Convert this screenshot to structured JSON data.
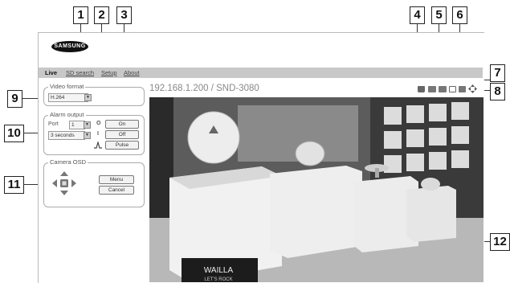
{
  "app": {
    "logo_text": "SAMSUNG",
    "menu": [
      {
        "label": "Live"
      },
      {
        "label": "SD search"
      },
      {
        "label": "Setup"
      },
      {
        "label": "About"
      }
    ],
    "camera_title": "192.168.1.200 / SND-3080"
  },
  "side_panel": {
    "video_format": {
      "legend": "Video format",
      "value": "H.264"
    },
    "alarm_output": {
      "legend": "Alarm output",
      "port_label": "Port",
      "port_value": "1",
      "duration_value": "3 seconds",
      "on_label": "On",
      "off_label": "Off",
      "pulse_label": "Pulse"
    },
    "camera_osd": {
      "legend": "Camera OSD",
      "menu_label": "Menu",
      "cancel_label": "Cancel"
    }
  },
  "callouts": [
    "1",
    "2",
    "3",
    "4",
    "5",
    "6",
    "7",
    "8",
    "9",
    "10",
    "11",
    "12"
  ],
  "video_overlay_text": [
    "WAILLA",
    "LET'S ROCK"
  ],
  "icons": [
    "print-icon",
    "capture-icon",
    "record-icon",
    "fullscreen-icon",
    "settings-icon",
    "ptz-arrows-icon"
  ],
  "colors": {
    "menu_bar": "#c8c8c8",
    "frame_border": "#bbbbbb"
  }
}
